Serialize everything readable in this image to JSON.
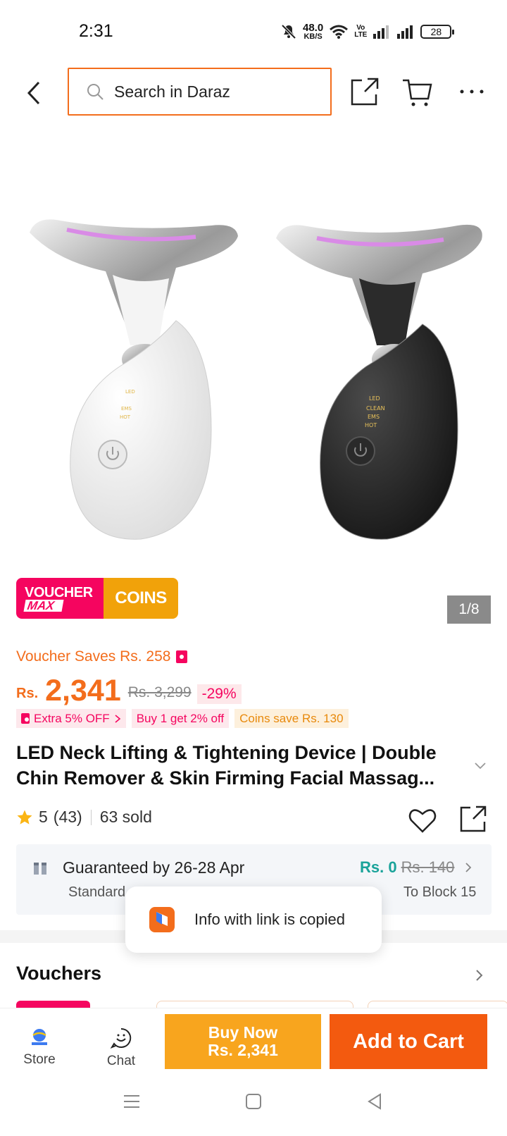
{
  "status_bar": {
    "time": "2:31",
    "net_speed_value": "48.0",
    "net_speed_unit": "KB/S",
    "volte_top": "Vo",
    "volte_bottom": "LTE",
    "battery": "28"
  },
  "header": {
    "search_placeholder": "Search in Daraz"
  },
  "product": {
    "image_counter": "1/8",
    "promo_voucher_line1": "VOUCHER",
    "promo_voucher_line2": "MAX",
    "promo_coins": "COINS",
    "voucher_saves": "Voucher Saves Rs. 258",
    "price_currency": "Rs.",
    "price": "2,341",
    "original_price": "Rs. 3,299",
    "discount": "-29%",
    "tags": [
      "Extra 5% OFF",
      "Buy 1 get 2% off",
      "Coins save Rs. 130"
    ],
    "title": "LED Neck Lifting & Tightening Device | Double Chin Remover & Skin Firming Facial Massag...",
    "rating": "5",
    "review_count": "(43)",
    "sold": "63 sold",
    "image_labels": [
      "LED",
      "EMS",
      "HOT"
    ],
    "image_labels_black": [
      "LED",
      "CLEAN",
      "EMS",
      "HOT"
    ]
  },
  "delivery": {
    "guarantee": "Guaranteed by 26-28 Apr",
    "type": "Standard",
    "price": "Rs. 0",
    "original_price": "Rs. 140",
    "location": "To Block 15"
  },
  "vouchers": {
    "heading": "Vouchers"
  },
  "toast": {
    "text": "Info with link is copied"
  },
  "bottom_bar": {
    "store_label": "Store",
    "chat_label": "Chat",
    "buy_now_line1": "Buy Now",
    "buy_now_line2": "Rs. 2,341",
    "add_to_cart": "Add to Cart"
  },
  "colors": {
    "accent": "#f36d1c",
    "voucher_pink": "#f5055f",
    "coins_yellow": "#f1a20a",
    "buy_now": "#f8a51e",
    "add_to_cart": "#f35a0f",
    "free_delivery": "#1aa39a"
  }
}
